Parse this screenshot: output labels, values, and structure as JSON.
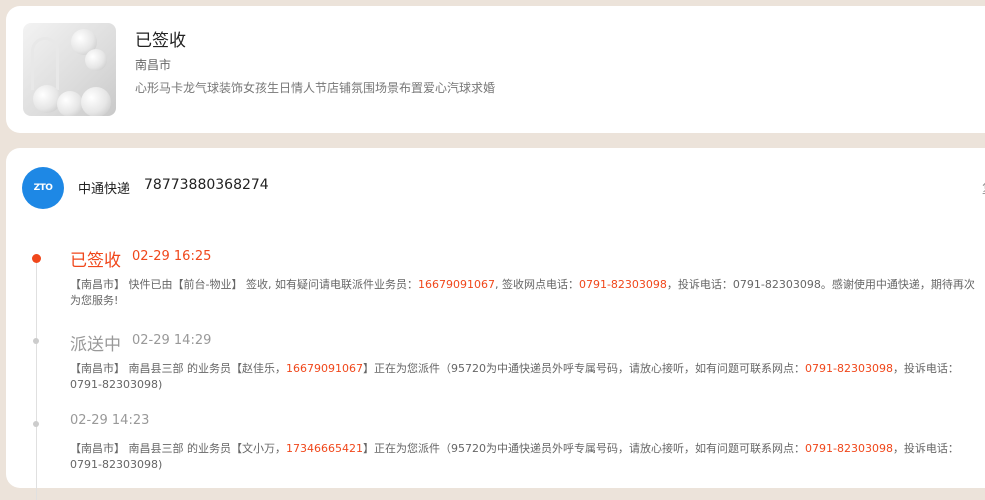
{
  "product": {
    "status": "已签收",
    "city": "南昌市",
    "name": "心形马卡龙气球装饰女孩生日情人节店铺氛围场景布置爱心汽球求婚"
  },
  "courier": {
    "logo_text": "ZTO",
    "name": "中通快递",
    "tracking_number": "78773880368274",
    "edge_char": "复"
  },
  "events": [
    {
      "status": "已签收",
      "time": "02-29 16:25",
      "desc": {
        "p1": "【南昌市】 快件已由【前台-物业】 签收, 如有疑问请电联派件业务员：",
        "h1": "16679091067",
        "p2": ", 签收网点电话：",
        "h2": "0791-82303098",
        "p3": "，投诉电话：0791-82303098。感谢使用中通快递，期待再次为您服务!"
      }
    },
    {
      "status": "派送中",
      "time": "02-29 14:29",
      "desc": {
        "p1": "【南昌市】 南昌县三部 的业务员【赵佳乐，",
        "h1": "16679091067",
        "p2": "】正在为您派件（95720为中通快递员外呼专属号码，请放心接听，如有问题可联系网点：",
        "h2": "0791-82303098",
        "p3": "，投诉电话：0791-82303098)"
      }
    },
    {
      "status": "",
      "time": "02-29 14:23",
      "desc": {
        "p1": "【南昌市】 南昌县三部 的业务员【文小万，",
        "h1": "17346665421",
        "p2": "】正在为您派件（95720为中通快递员外呼专属号码，请放心接听，如有问题可联系网点：",
        "h2": "0791-82303098",
        "p3": "，投诉电话：0791-82303098)"
      }
    }
  ],
  "colors": {
    "accent": "#f0471b",
    "courier_blue": "#1e88e5",
    "background": "#ece3da"
  }
}
